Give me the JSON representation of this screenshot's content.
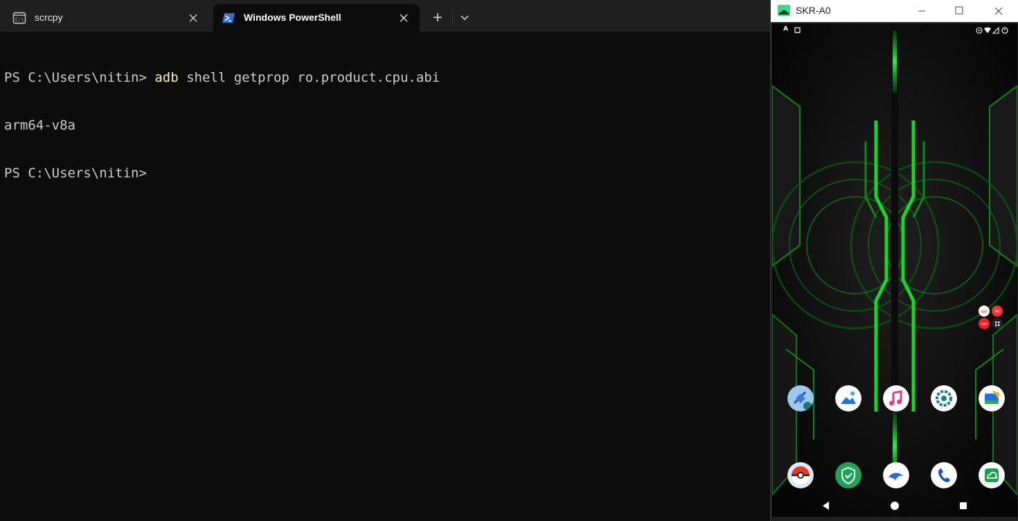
{
  "terminal": {
    "tabs": [
      {
        "label": "scrcpy",
        "active": false,
        "icon": "console-icon"
      },
      {
        "label": "Windows PowerShell",
        "active": true,
        "icon": "powershell-icon"
      }
    ],
    "new_tab_icon": "plus-icon",
    "dropdown_icon": "chevron-down-icon",
    "console": {
      "line1_prompt": "PS C:\\Users\\nitin> ",
      "line1_cmd": "adb",
      "line1_args": " shell getprop ro.product.cpu.abi",
      "line2": "arm64-v8a",
      "line3_prompt": "PS C:\\Users\\nitin>"
    },
    "colors": {
      "background": "#0c0c0c",
      "text": "#cccccc",
      "command": "#f9f1a5",
      "tabbar": "#1f1f1f"
    }
  },
  "scrcpy_window": {
    "title": "SKR-A0",
    "controls": [
      "minimize-icon",
      "maximize-icon",
      "close-icon"
    ],
    "status_bar": {
      "left_text": "A",
      "right_icons": [
        "do-not-disturb-icon",
        "wifi-icon",
        "signal-icon",
        "battery-icon"
      ]
    },
    "home_apps_row1": [
      "maps-icon",
      "gallery-icon",
      "music-icon",
      "settings-icon",
      "files-icon"
    ],
    "home_apps_row2": [
      "pokeball-game-icon",
      "security-shield-icon",
      "dolphin-browser-icon",
      "phone-icon",
      "cloud-icon"
    ],
    "widget_icons": [
      "oyo-icon",
      "wz-icon",
      "oyo-icon",
      "grid-icon"
    ],
    "nav_bar": [
      "back-icon",
      "home-icon",
      "recents-icon"
    ],
    "colors": {
      "accent": "#18c81e",
      "wallpaper_dark": "#0a0a0a"
    }
  }
}
